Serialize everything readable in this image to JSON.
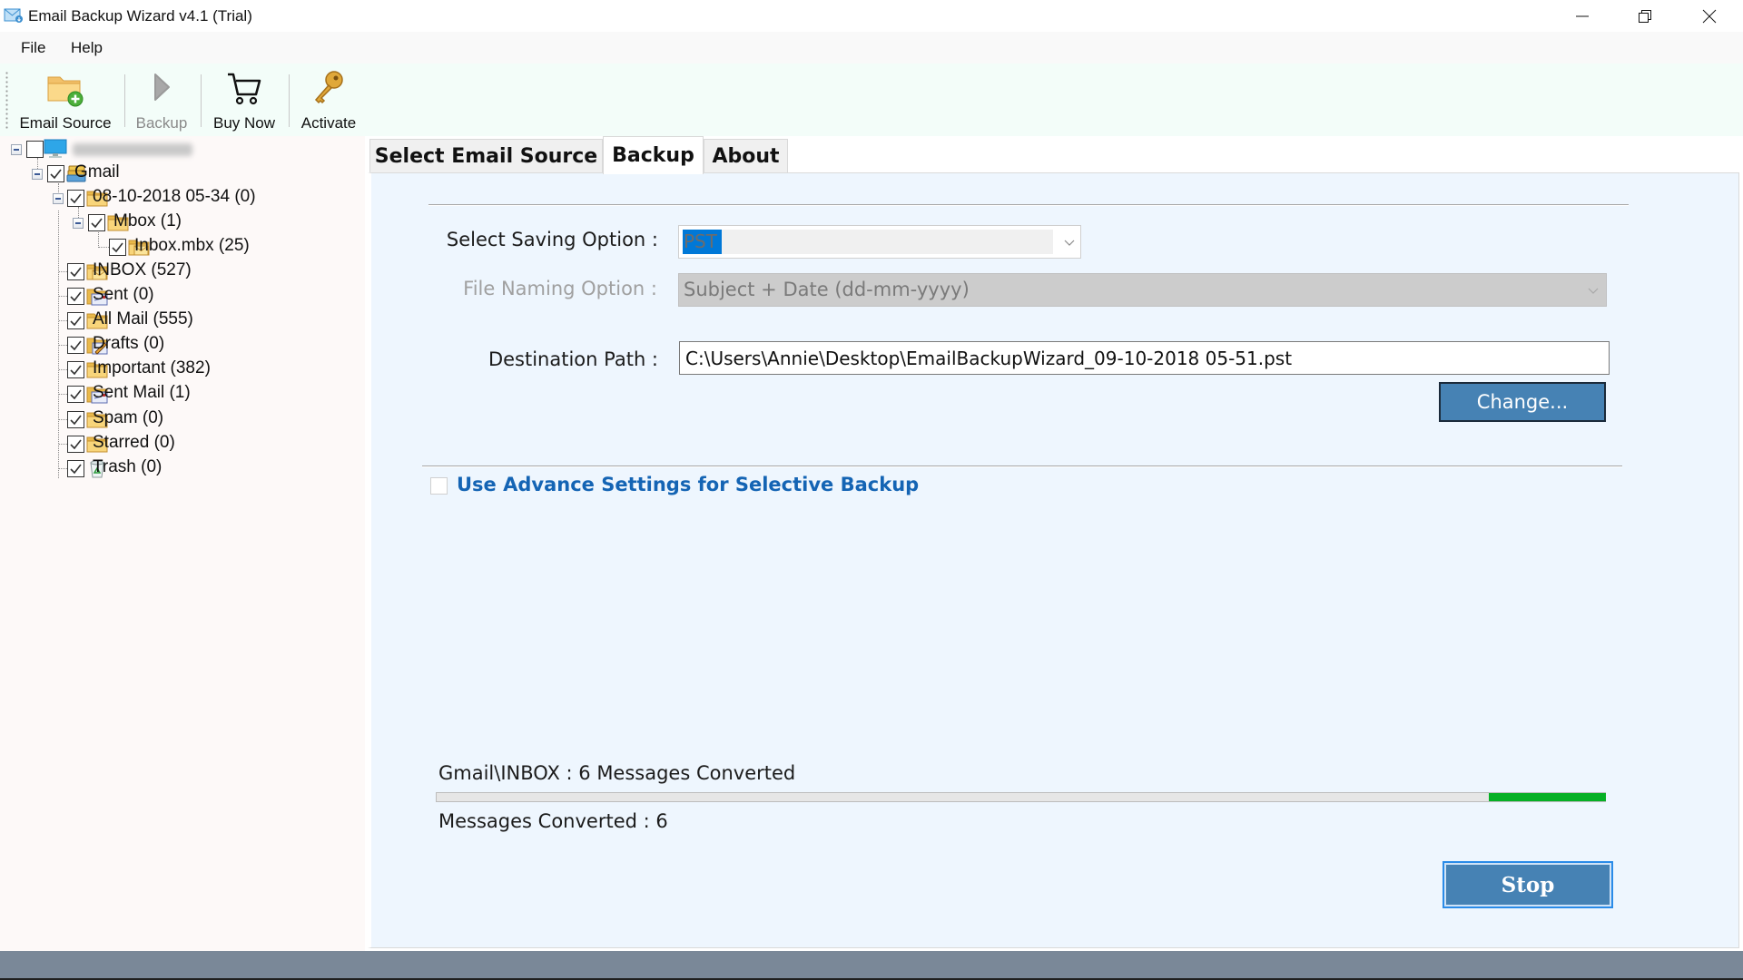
{
  "window": {
    "title": "Email Backup Wizard v4.1 (Trial)",
    "icons": {
      "app": "envelope-download-icon",
      "minimize": "minimize-icon",
      "restore": "restore-icon",
      "close": "close-icon"
    }
  },
  "menu": {
    "items": [
      {
        "label": "File"
      },
      {
        "label": "Help"
      }
    ]
  },
  "toolbar": {
    "buttons": [
      {
        "label": "Email Source",
        "icon": "folder-add-icon",
        "enabled": true
      },
      {
        "label": "Backup",
        "icon": "play-icon",
        "enabled": false
      },
      {
        "label": "Buy Now",
        "icon": "cart-icon",
        "enabled": true
      },
      {
        "label": "Activate",
        "icon": "key-icon",
        "enabled": true
      }
    ]
  },
  "tree": {
    "root": {
      "label": "[blurred computer name]",
      "checked": false,
      "icon": "computer-icon"
    },
    "nodes": [
      {
        "label": "Gmail",
        "checked": true,
        "icon": "mail-account-icon",
        "level": 1,
        "expanded": true
      },
      {
        "label": "08-10-2018 05-34 (0)",
        "checked": true,
        "icon": "folder-icon",
        "level": 2,
        "expanded": true
      },
      {
        "label": "Mbox (1)",
        "checked": true,
        "icon": "folder-icon",
        "level": 3,
        "expanded": true
      },
      {
        "label": "Inbox.mbx (25)",
        "checked": true,
        "icon": "mail-folder-icon",
        "level": 4
      },
      {
        "label": "INBOX (527)",
        "checked": true,
        "icon": "mail-folder-icon",
        "level": 2
      },
      {
        "label": "Sent (0)",
        "checked": true,
        "icon": "sent-folder-icon",
        "level": 2
      },
      {
        "label": "All Mail (555)",
        "checked": true,
        "icon": "folder-icon",
        "level": 2
      },
      {
        "label": "Drafts (0)",
        "checked": true,
        "icon": "drafts-folder-icon",
        "level": 2
      },
      {
        "label": "Important (382)",
        "checked": true,
        "icon": "folder-icon",
        "level": 2
      },
      {
        "label": "Sent Mail (1)",
        "checked": true,
        "icon": "sent-folder-icon",
        "level": 2
      },
      {
        "label": "Spam (0)",
        "checked": true,
        "icon": "folder-icon",
        "level": 2
      },
      {
        "label": "Starred (0)",
        "checked": true,
        "icon": "folder-icon",
        "level": 2
      },
      {
        "label": "Trash (0)",
        "checked": true,
        "icon": "recycle-bin-icon",
        "level": 2
      }
    ]
  },
  "tabs": [
    {
      "label": "Select Email Source",
      "active": false
    },
    {
      "label": "Backup",
      "active": true
    },
    {
      "label": "About",
      "active": false
    }
  ],
  "backup": {
    "saving_option": {
      "label": "Select Saving Option :",
      "value": "PST"
    },
    "file_naming": {
      "label": "File Naming Option :",
      "value": "Subject + Date (dd-mm-yyyy)",
      "enabled": false
    },
    "destination": {
      "label": "Destination Path :",
      "value": "C:\\Users\\Annie\\Desktop\\EmailBackupWizard_09-10-2018 05-51.pst"
    },
    "change_button": "Change...",
    "advance_settings": {
      "label": "Use Advance Settings for Selective Backup",
      "checked": false
    },
    "progress": {
      "current_text": "Gmail\\INBOX : 6 Messages Converted",
      "converted_text": "Messages Converted : 6",
      "marquee_start_fraction": 0.9,
      "marquee_end_fraction": 1.0
    },
    "stop_button": "Stop"
  },
  "colors": {
    "accent_button": "#4682b4",
    "progress_fill": "#06b025",
    "link_blue": "#1464b4",
    "selection": "#0078d7",
    "status_bar": "#7a8898"
  }
}
